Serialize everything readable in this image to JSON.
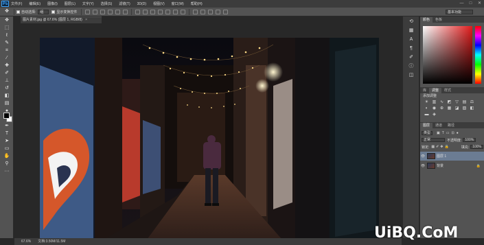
{
  "app": {
    "logo": "Ps"
  },
  "menu": [
    "文件(F)",
    "编辑(E)",
    "图像(I)",
    "图层(L)",
    "文字(Y)",
    "选择(S)",
    "滤镜(T)",
    "3D(D)",
    "视图(V)",
    "窗口(W)",
    "帮助(H)"
  ],
  "window_buttons": [
    "—",
    "□",
    "✕"
  ],
  "options_bar": {
    "auto_select_label": "自动选择:",
    "auto_select_value": "组",
    "show_transform_label": "显示变换控件",
    "workspace": "基本功能"
  },
  "document": {
    "tab_title": "图片素材.jpg @ 67.6% (图层 1, RGB/8)",
    "close": "×"
  },
  "status": {
    "zoom": "67.6%",
    "doc_info": "文档:3.50M/11.5M"
  },
  "panels": {
    "color_tabs": [
      "颜色",
      "色板"
    ],
    "adjust_tabs": [
      "库",
      "调整",
      "样式"
    ],
    "adjust_title": "添加调整",
    "layers_tabs": [
      "图层",
      "通道",
      "路径"
    ],
    "kind_label": "类型",
    "blend_mode": "正常",
    "opacity_label": "不透明度:",
    "opacity_value": "100%",
    "lock_label": "锁定:",
    "fill_label": "填充:",
    "fill_value": "100%",
    "layers": [
      {
        "name": "图层 1",
        "active": true
      },
      {
        "name": "背景",
        "active": false
      }
    ]
  },
  "watermark": "UiBQ.CoM",
  "colors": {
    "foreground": "#000000",
    "background": "#ffffff",
    "selected_layer": "#6b7c93",
    "accent_red": "#e11b1b"
  }
}
